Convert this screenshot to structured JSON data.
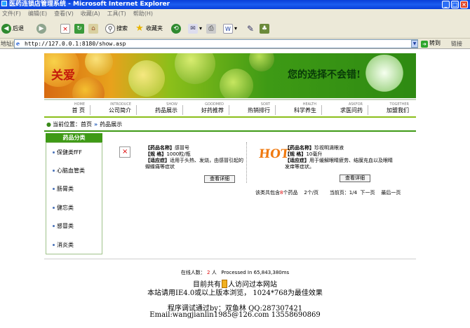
{
  "window": {
    "title": "医药连锁店管理系统 - Microsoft Internet Explorer",
    "controls": {
      "minimize": "_",
      "maximize": "□",
      "close": "×"
    }
  },
  "menu": [
    "文件(F)",
    "编辑(E)",
    "查看(V)",
    "收藏(A)",
    "工具(T)",
    "帮助(H)"
  ],
  "toolbar": {
    "back": "后退",
    "search": "搜索",
    "favorites": "收藏夹"
  },
  "address": {
    "label": "地址(D)",
    "url": "http://127.0.0.1:8180/show.asp",
    "go": "转到",
    "links": "链接"
  },
  "banner": {
    "logo": "关爱",
    "slogan": "您的选择不会错!"
  },
  "nav": [
    {
      "en": "HOME",
      "zh": "首 页"
    },
    {
      "en": "INTRODUCE",
      "zh": "公司简介"
    },
    {
      "en": "SHOW",
      "zh": "药品展示"
    },
    {
      "en": "GOODMED",
      "zh": "好药推荐"
    },
    {
      "en": "SORT",
      "zh": "热销排行"
    },
    {
      "en": "HEALTH",
      "zh": "科学养生"
    },
    {
      "en": "ASKFOR",
      "zh": "求医问药"
    },
    {
      "en": "TOGETHER",
      "zh": "加盟我们"
    }
  ],
  "breadcrumb": {
    "prefix": "当前位置：首页",
    "current": "药品展示"
  },
  "sidebar": {
    "title": "药品分类",
    "items": [
      "保健类fFF",
      "心脑血管类",
      "肠胃类",
      "健忘类",
      "感冒类",
      "消炎类"
    ]
  },
  "products": [
    {
      "name_label": "【药品名称】",
      "name": "感冒号",
      "spec_label": "【规 格】",
      "spec": "1000粒/瓶",
      "use_label": "【适应症】",
      "use": "适用于头热、发烧，由感冒引起的蝴蝶痛等症状",
      "button": "查看详细"
    },
    {
      "name_label": "【药品名称】",
      "name": "珍视明滴眼液",
      "spec_label": "【规 格】",
      "spec": "10毫升",
      "use_label": "【适应症】",
      "use": "用于缓解眼睛疲劳、结膜充血以及眼睛发痒等症状。",
      "button": "查看详细",
      "badge": "HOT"
    }
  ],
  "pager": {
    "text1": "该类共包含",
    "count": "8",
    "text2": "个药品",
    "perpage": "2个/页",
    "current": "当前页：1/4",
    "next": "下一页",
    "last": "最后一页"
  },
  "footer": {
    "online_label": "在线人数：",
    "online_count": "2",
    "online_unit": "人",
    "processed": "Processed In 65,843,380ms",
    "visits_a": "目前共有",
    "visits_b": "人访问过本网站",
    "browser": "本站请用IE4.0或以上版本浏览，  1024*768为最佳效果",
    "debug": "程序调试通过by：双鱼林 QQ:287307421",
    "email": "Email:wangjianlin1985@126.com 13558690869"
  },
  "colors": {
    "titlebar": "#0a3fd8",
    "accent_green": "#3e9a15",
    "red": "#d00000"
  }
}
